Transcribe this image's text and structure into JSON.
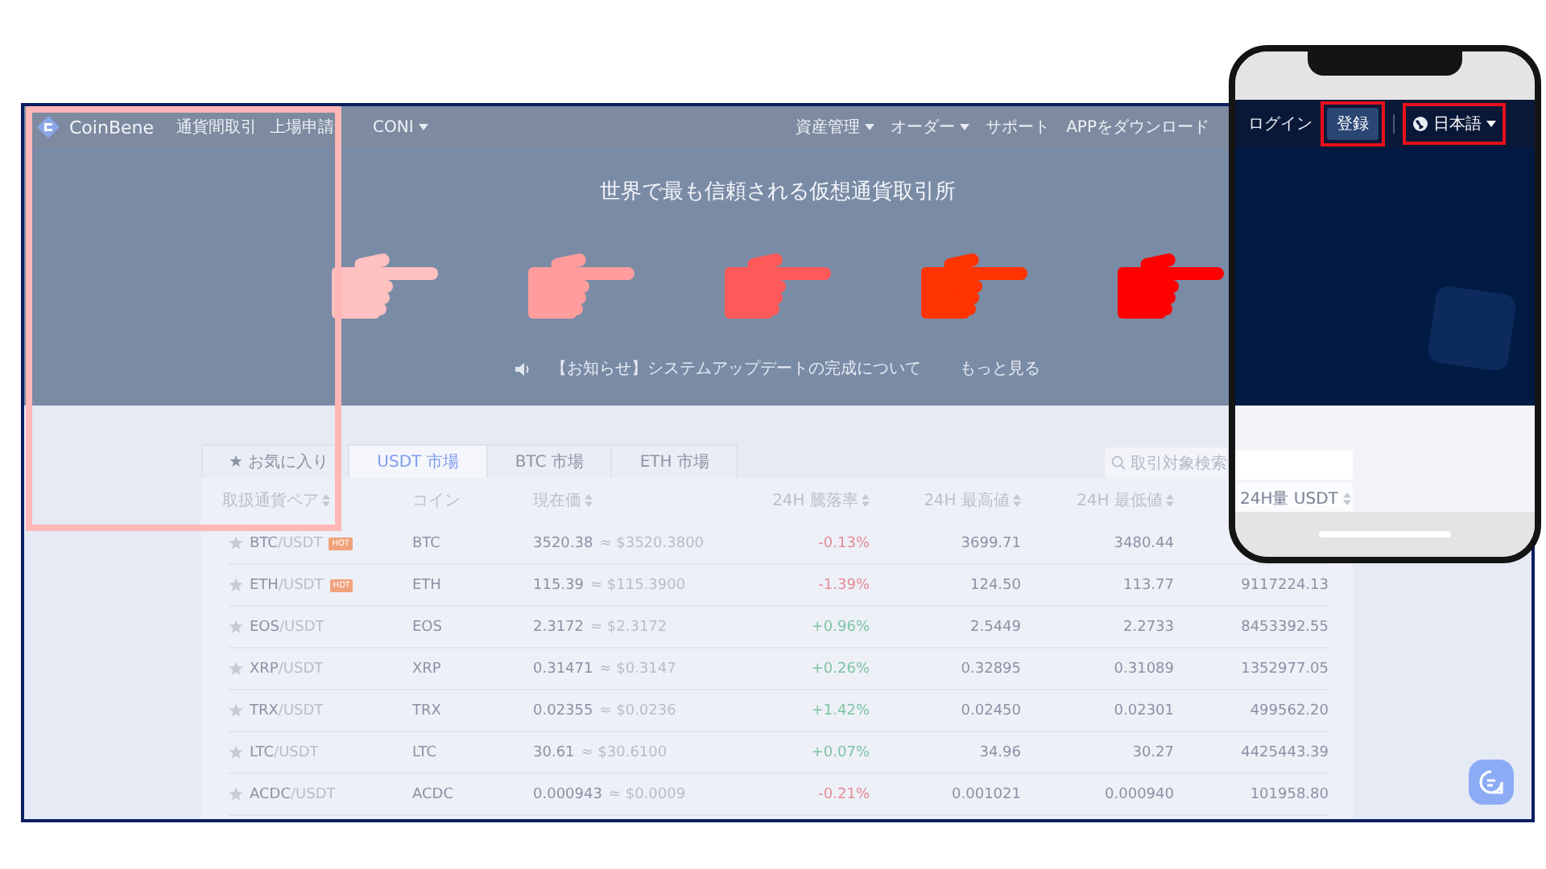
{
  "nav": {
    "brand": "CoinBene",
    "left_items": [
      {
        "label": "通貨間取引",
        "dropdown": false
      },
      {
        "label": "上場申請",
        "dropdown": false
      },
      {
        "label": "CONI",
        "dropdown": true
      }
    ],
    "right_items": [
      {
        "label": "資産管理",
        "dropdown": true
      },
      {
        "label": "オーダー",
        "dropdown": true
      },
      {
        "label": "サポート",
        "dropdown": false
      },
      {
        "label": "APPをダウンロード",
        "dropdown": false
      }
    ]
  },
  "hero": {
    "title": "世界で最も信頼される仮想通貨取引所",
    "notice": "【お知らせ】システムアップデートの完成について",
    "more": "もっと見る"
  },
  "hands": [
    {
      "color": "#ffc0c0"
    },
    {
      "color": "#ff9c9c"
    },
    {
      "color": "#ff5a5a"
    },
    {
      "color": "#ff3300"
    },
    {
      "color": "#ff0000"
    }
  ],
  "tabs": [
    {
      "label": "★ お気に入り",
      "selected": false
    },
    {
      "label": "USDT 市場",
      "selected": true
    },
    {
      "label": "BTC 市場",
      "selected": false
    },
    {
      "label": "ETH 市場",
      "selected": false
    }
  ],
  "search": {
    "placeholder": "取引対象検索"
  },
  "table": {
    "columns": [
      {
        "label": "取扱通貨ペア",
        "sortable": true
      },
      {
        "label": "コイン",
        "sortable": false
      },
      {
        "label": "現在価",
        "sortable": true
      },
      {
        "label": "24H 騰落率",
        "sortable": true
      },
      {
        "label": "24H 最高値",
        "sortable": true
      },
      {
        "label": "24H 最低値",
        "sortable": true
      }
    ],
    "rows": [
      {
        "favorite": false,
        "pair": "BTC/USDT",
        "badge": "HOT",
        "coin": "BTC",
        "price": "3520.38",
        "approx": "≈ $3520.3800",
        "change": "-0.13%",
        "color": "#e58b97",
        "high": "3699.71",
        "low": "3480.44"
      },
      {
        "favorite": false,
        "pair": "ETH/USDT",
        "badge": "HOT",
        "coin": "ETH",
        "price": "115.39",
        "approx": "≈ $115.3900",
        "change": "-1.39%",
        "color": "#e58b97",
        "high": "124.50",
        "low": "113.77",
        "volume": "9117224.13"
      },
      {
        "favorite": false,
        "pair": "EOS/USDT",
        "coin": "EOS",
        "price": "2.3172",
        "approx": "≈ $2.3172",
        "change": "+0.96%",
        "color": "#7fc3a3",
        "high": "2.5449",
        "low": "2.2733",
        "volume": "8453392.55"
      },
      {
        "favorite": false,
        "pair": "XRP/USDT",
        "coin": "XRP",
        "price": "0.31471",
        "approx": "≈ $0.3147",
        "change": "+0.26%",
        "color": "#7fc3a3",
        "high": "0.32895",
        "low": "0.31089",
        "volume": "1352977.05"
      },
      {
        "favorite": false,
        "pair": "TRX/USDT",
        "coin": "TRX",
        "price": "0.02355",
        "approx": "≈ $0.0236",
        "change": "+1.42%",
        "color": "#7fc3a3",
        "high": "0.02450",
        "low": "0.02301",
        "volume": "499562.20"
      },
      {
        "favorite": false,
        "pair": "LTC/USDT",
        "coin": "LTC",
        "price": "30.61",
        "approx": "≈ $30.6100",
        "change": "+0.07%",
        "color": "#7fc3a3",
        "high": "34.96",
        "low": "30.27",
        "volume": "4425443.39"
      },
      {
        "favorite": false,
        "pair": "ACDC/USDT",
        "coin": "ACDC",
        "price": "0.000943",
        "approx": "≈ $0.0009",
        "change": "-0.21%",
        "color": "#e58b97",
        "high": "0.001021",
        "low": "0.000940",
        "volume": "101958.80"
      }
    ]
  },
  "phone": {
    "login": "ログイン",
    "register": "登録",
    "language": "日本語",
    "column_header": {
      "label": "24H量 USDT",
      "sortable": true
    }
  }
}
